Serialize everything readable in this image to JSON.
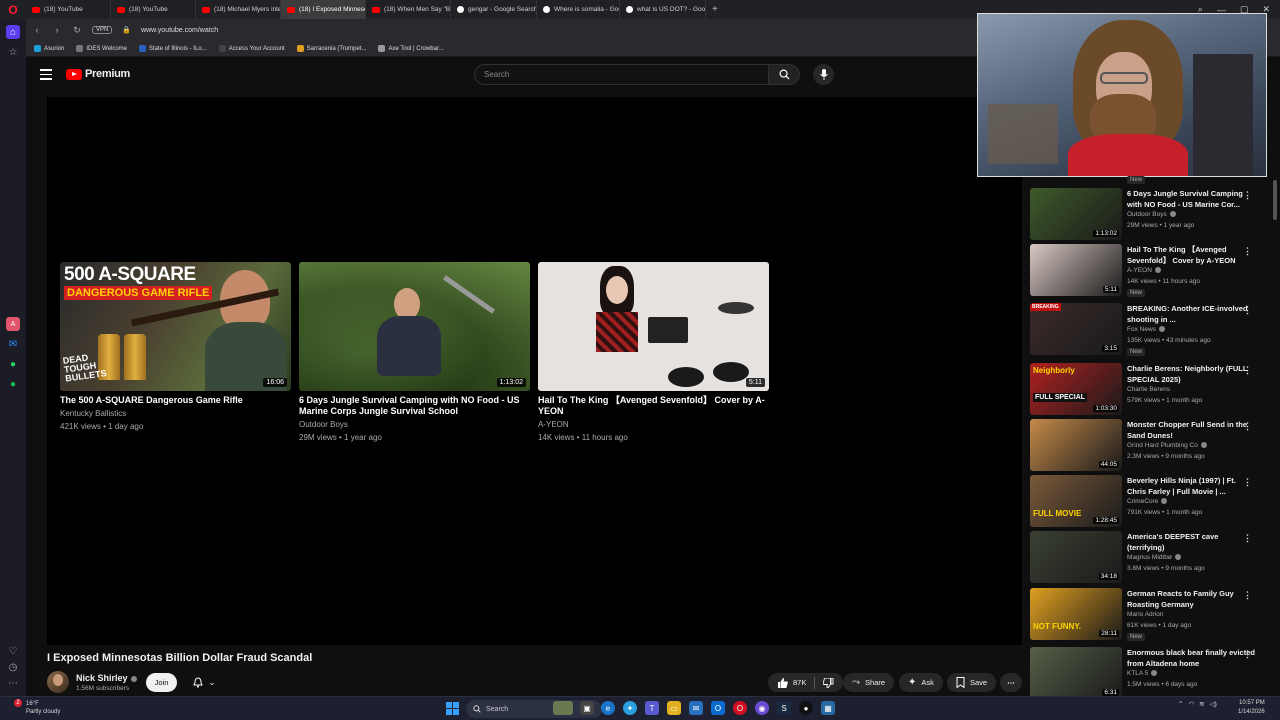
{
  "browser": {
    "tabs": [
      {
        "label": "(18) YouTube",
        "active": false,
        "icon": "youtube-icon"
      },
      {
        "label": "(18) YouTube",
        "active": false,
        "icon": "youtube-icon"
      },
      {
        "label": "(18) Michael Myers interv",
        "active": false,
        "icon": "youtube-icon"
      },
      {
        "label": "(18) I Exposed Minnesota",
        "active": true,
        "icon": "youtube-icon"
      },
      {
        "label": "(18) When Men Say \"Be R",
        "active": false,
        "icon": "youtube-icon"
      },
      {
        "label": "gengar - Google Search",
        "active": false,
        "icon": "google-icon"
      },
      {
        "label": "Where is somalia - Googl",
        "active": false,
        "icon": "google-icon"
      },
      {
        "label": "what is US DOT? - Googl",
        "active": false,
        "icon": "google-icon"
      }
    ],
    "address": "www.youtube.com/watch",
    "vpn_label": "VPN",
    "bookmarks": [
      "Asurion",
      "IDES Welcome",
      "State of Illinois - ILo...",
      "Access Your Account",
      "Sarracenia (Trumpet...",
      "Axe Tool | Crowbar..."
    ]
  },
  "youtube": {
    "brand": "Premium",
    "search_placeholder": "Search"
  },
  "end_cards": [
    {
      "title": "The 500 A-SQUARE Dangerous Game Rifle",
      "channel": "Kentucky Ballistics",
      "meta": "421K views • 1 day ago",
      "duration": "16:06",
      "thumb_text_1": "500 A-SQUARE",
      "thumb_text_2": "DANGEROUS GAME RIFLE",
      "thumb_text_3": "DEAD TOUGH BULLETS"
    },
    {
      "title": "6 Days Jungle Survival Camping with NO Food - US Marine Corps Jungle Survival School",
      "channel": "Outdoor Boys",
      "meta": "29M views • 1 year ago",
      "duration": "1:13:02"
    },
    {
      "title": "Hail To The King 【Avenged Sevenfold】 Cover by A-YEON",
      "channel": "A-YEON",
      "meta": "14K views • 11 hours ago",
      "duration": "5:11"
    }
  ],
  "video": {
    "title": "I Exposed Minnesotas Billion Dollar Fraud Scandal",
    "channel": "Nick Shirley",
    "subscribers": "1.56M subscribers",
    "join_label": "Join",
    "likes": "87K",
    "share_label": "Share",
    "ask_label": "Ask",
    "save_label": "Save"
  },
  "rail_top_badge": "New",
  "rail": [
    {
      "title": "6 Days Jungle Survival Camping with NO Food - US Marine Cor...",
      "channel": "Outdoor Boys",
      "meta": "29M views • 1 year ago",
      "duration": "1:13:02",
      "new": "",
      "verified": true,
      "color": "#3f5a2a"
    },
    {
      "title": "Hail To The King 【Avenged Sevenfold】 Cover by A-YEON",
      "channel": "A-YEON",
      "meta": "14K views • 11 hours ago",
      "duration": "5:11",
      "new": "New",
      "verified": true,
      "color": "#d9c9c4"
    },
    {
      "title": "BREAKING: Another ICE-involved shooting in ...",
      "channel": "Fox News",
      "meta": "135K views • 43 minutes ago",
      "duration": "3:15",
      "new": "New",
      "verified": true,
      "color": "#3b2a2a",
      "badge": "BREAKING"
    },
    {
      "title": "Charlie Berens: Neighborly (FULL SPECIAL 2025)",
      "channel": "Charlie Berens",
      "meta": "579K views • 1 month ago",
      "duration": "1:03:30",
      "new": "",
      "verified": false,
      "color": "#b02020",
      "overlay_1": "Neighborly",
      "overlay_2": "FULL SPECIAL"
    },
    {
      "title": "Monster Chopper Full Send in the Sand Dunes!",
      "channel": "Grind Hard Plumbing Co",
      "meta": "2.3M views • 9 months ago",
      "duration": "44:05",
      "new": "",
      "verified": true,
      "color": "#c58a4a"
    },
    {
      "title": "Beverley Hills Ninja (1997) | Ft. Chris Farley | Full Movie | ...",
      "channel": "CrimeCore",
      "meta": "791K views • 1 month ago",
      "duration": "1:28:45",
      "new": "",
      "verified": true,
      "color": "#7a5a3a",
      "overlay_1": "FULL MOVIE"
    },
    {
      "title": "America's DEEPEST cave (terrifying)",
      "channel": "Magnus Midtbø",
      "meta": "3.8M views • 9 months ago",
      "duration": "34:18",
      "new": "",
      "verified": true,
      "color": "#3a4032"
    },
    {
      "title": "German Reacts to Family Guy Roasting Germany",
      "channel": "Mario Adrion",
      "meta": "61K views • 1 day ago",
      "duration": "28:11",
      "new": "New",
      "verified": false,
      "color": "#e0a020",
      "overlay_1": "NOT FUNNY."
    },
    {
      "title": "Enormous black bear finally evicted from Altadena home",
      "channel": "KTLA 5",
      "meta": "1.5M views • 6 days ago",
      "duration": "6:31",
      "new": "",
      "verified": true,
      "color": "#556048"
    }
  ],
  "taskbar": {
    "weather_temp": "16°F",
    "weather_desc": "Partly cloudy",
    "weather_badge": "2",
    "search_label": "Search",
    "time": "10:57 PM",
    "date": "1/14/2026"
  }
}
